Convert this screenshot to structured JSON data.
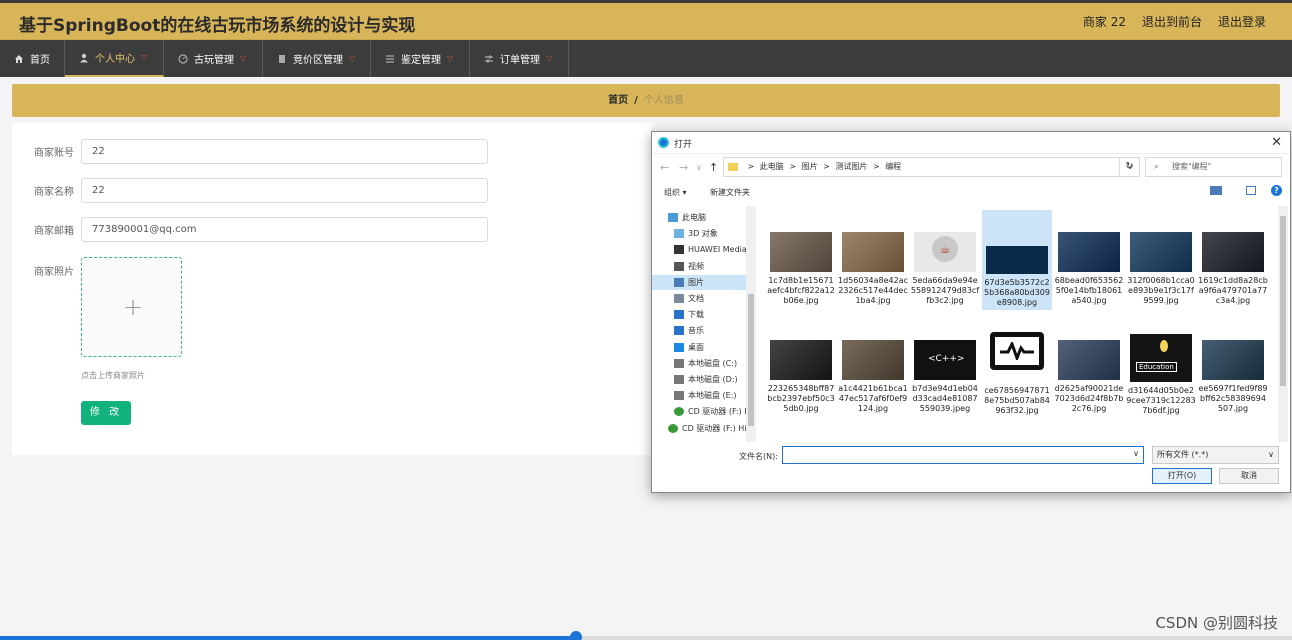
{
  "app": {
    "title": "基于SpringBoot的在线古玩市场系统的设计与实现",
    "user_label": "商家 22",
    "front_link": "退出到前台",
    "logout_link": "退出登录"
  },
  "nav": {
    "items": [
      {
        "label": "首页",
        "icon": "home-icon"
      },
      {
        "label": "个人中心",
        "icon": "user-icon"
      },
      {
        "label": "古玩管理",
        "icon": "dashboard-icon"
      },
      {
        "label": "竞价区管理",
        "icon": "document-icon"
      },
      {
        "label": "鉴定管理",
        "icon": "list-icon"
      },
      {
        "label": "订单管理",
        "icon": "sliders-icon"
      }
    ],
    "active_index": 1
  },
  "breadcrumb": {
    "home": "首页",
    "separator": "/",
    "current": "个人信息"
  },
  "form": {
    "account_label": "商家账号",
    "account_value": "22",
    "name_label": "商家名称",
    "name_value": "22",
    "email_label": "商家邮箱",
    "email_value": "773890001@qq.com",
    "photo_label": "商家照片",
    "upload_plus": "+",
    "upload_tip": "点击上传商家照片",
    "submit_label": "修 改"
  },
  "dialog": {
    "title": "打开",
    "close": "✕",
    "path": [
      "此电脑",
      "图片",
      "测试图片",
      "编程"
    ],
    "path_sep": ">",
    "search_placeholder": "搜索\"编程\"",
    "organize": "组织 ▾",
    "new_folder": "新建文件夹",
    "help": "?",
    "tree": [
      {
        "label": "此电脑",
        "icon": "computer-icon",
        "indent": 0
      },
      {
        "label": "3D 对象",
        "icon": "cube-icon",
        "indent": 1
      },
      {
        "label": "HUAWEI Media",
        "icon": "phone-icon",
        "indent": 1
      },
      {
        "label": "视频",
        "icon": "video-icon",
        "indent": 1
      },
      {
        "label": "图片",
        "icon": "picture-icon",
        "indent": 1,
        "selected": true
      },
      {
        "label": "文档",
        "icon": "document-icon",
        "indent": 1
      },
      {
        "label": "下载",
        "icon": "download-icon",
        "indent": 1
      },
      {
        "label": "音乐",
        "icon": "music-icon",
        "indent": 1
      },
      {
        "label": "桌面",
        "icon": "desktop-icon",
        "indent": 1
      },
      {
        "label": "本地磁盘 (C:)",
        "icon": "drive-icon",
        "indent": 1
      },
      {
        "label": "本地磁盘 (D:)",
        "icon": "drive-icon",
        "indent": 1
      },
      {
        "label": "本地磁盘 (E:)",
        "icon": "drive-icon",
        "indent": 1
      },
      {
        "label": "CD 驱动器 (F:) H",
        "icon": "cd-drive-icon",
        "indent": 1
      },
      {
        "label": "CD 驱动器 (F:) Hi",
        "icon": "cd-drive-icon",
        "indent": 0
      }
    ],
    "files": [
      {
        "name": "1c7d8b1e15671aefc4bfcf822a12b06e.jpg",
        "thumb": "laptop-photo",
        "color": "#6b5a4a"
      },
      {
        "name": "1d56034a8e42ac2326c517e44dec1ba4.jpg",
        "thumb": "keyboard-photo",
        "color": "#8a6a4a"
      },
      {
        "name": "5eda66da9e94e558912479d83cffb3c2.jpg",
        "thumb": "java-logo",
        "color": "#e8e8e8"
      },
      {
        "name": "67d3e5b3572c25b368a80bd309e8908.jpg",
        "thumb": "digital-wave",
        "color": "#0a2a4a",
        "selected": true
      },
      {
        "name": "68bead0f6535625f0e14bfb18061a540.jpg",
        "thumb": "code-blue",
        "color": "#0e2e5a"
      },
      {
        "name": "312f0068b1cca0e893b9e1f3c17f9599.jpg",
        "thumb": "code-screen",
        "color": "#153a5e"
      },
      {
        "name": "1619c1dd8a28cba9f6a479701a77c3a4.jpg",
        "thumb": "code-dark",
        "color": "#1a1f26"
      },
      {
        "name": "223265348bff87bcb2397ebf50c35db0.jpg",
        "thumb": "robot-head",
        "color": "#1a1a1a"
      },
      {
        "name": "a1c4421b61bca147ec517af6f0ef9124.jpg",
        "thumb": "laptop-hands",
        "color": "#5a4a3a"
      },
      {
        "name": "b7d3e94d1eb04d33cad4e81087559039.jpeg",
        "thumb": "cpp-chalk",
        "color": "#111111"
      },
      {
        "name": "ce678569478718e75bd507ab84963f32.jpg",
        "thumb": "monitor-icon",
        "color": "#ffffff"
      },
      {
        "name": "d2625af90021de7023d6d24f8b7b2c76.jpg",
        "thumb": "magnifier-photo",
        "color": "#2d3e5e"
      },
      {
        "name": "d31644d05b0e29cee7319c122837b6df.jpg",
        "thumb": "education-chalk",
        "color": "#141414"
      },
      {
        "name": "ee5697f1fed9f89bff62c58389694507.jpg",
        "thumb": "typing-photo",
        "color": "#1e3a52"
      },
      {
        "name": "",
        "thumb": "partial-photo",
        "color": "#3a4a5a"
      }
    ],
    "filename_label": "文件名(N):",
    "filename_value": "",
    "filetype_value": "所有文件 (*.*)",
    "open_label": "打开(O)",
    "cancel_label": "取消"
  },
  "watermark": "CSDN @别圆科技",
  "video_progress": 0.446
}
